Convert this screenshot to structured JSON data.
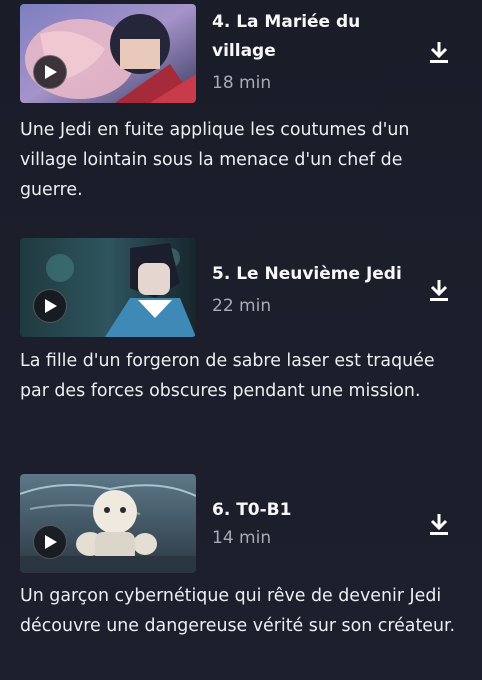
{
  "episodes": [
    {
      "title": "4. La Mariée du village",
      "duration": "18 min",
      "description": "Une Jedi en fuite applique les coutumes d'un village lointain sous la menace d'un chef de guerre.",
      "thumbnail_palette": [
        "#5a6aa8",
        "#e7a4b4",
        "#2a2a40"
      ]
    },
    {
      "title": "5. Le Neuvième Jedi",
      "duration": "22 min",
      "description": "La fille d'un forgeron de sabre laser est traquée par des forces obscures pendant une mission.",
      "thumbnail_palette": [
        "#2b4a52",
        "#3f7aa0",
        "#0f1a20"
      ]
    },
    {
      "title": "6. T0-B1",
      "duration": "14 min",
      "description": "Un garçon cybernétique qui rêve de devenir Jedi découvre une dangereuse vérité sur son créateur.",
      "thumbnail_palette": [
        "#6c8a9c",
        "#e9e4da",
        "#34424e"
      ]
    }
  ],
  "icons": {
    "play": "play-icon",
    "download": "download-icon"
  },
  "colors": {
    "background": "#1c1e2b",
    "title": "#f7f7f9",
    "duration": "#a9abb3",
    "text": "#eceef2"
  }
}
